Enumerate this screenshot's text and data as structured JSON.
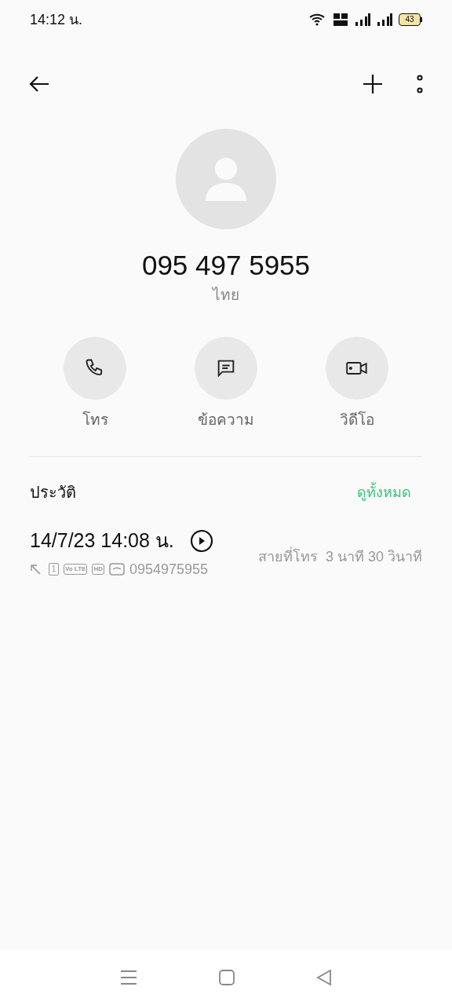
{
  "status_bar": {
    "time": "14:12 น.",
    "battery": "43"
  },
  "contact": {
    "number": "095 497 5955",
    "location": "ไทย"
  },
  "actions": [
    {
      "kind": "call",
      "label": "โทร"
    },
    {
      "kind": "message",
      "label": "ข้อความ"
    },
    {
      "kind": "video",
      "label": "วิดีโอ"
    }
  ],
  "history": {
    "title": "ประวัติ",
    "see_all": "ดูทั้งหมด",
    "entries": [
      {
        "datetime": "14/7/23 14:08 น.",
        "sim": "1",
        "badges": [
          "Vo LTE",
          "HD"
        ],
        "number": "0954975955",
        "type": "สายที่โทร",
        "duration": "3 นาที 30 วินาที"
      }
    ]
  }
}
